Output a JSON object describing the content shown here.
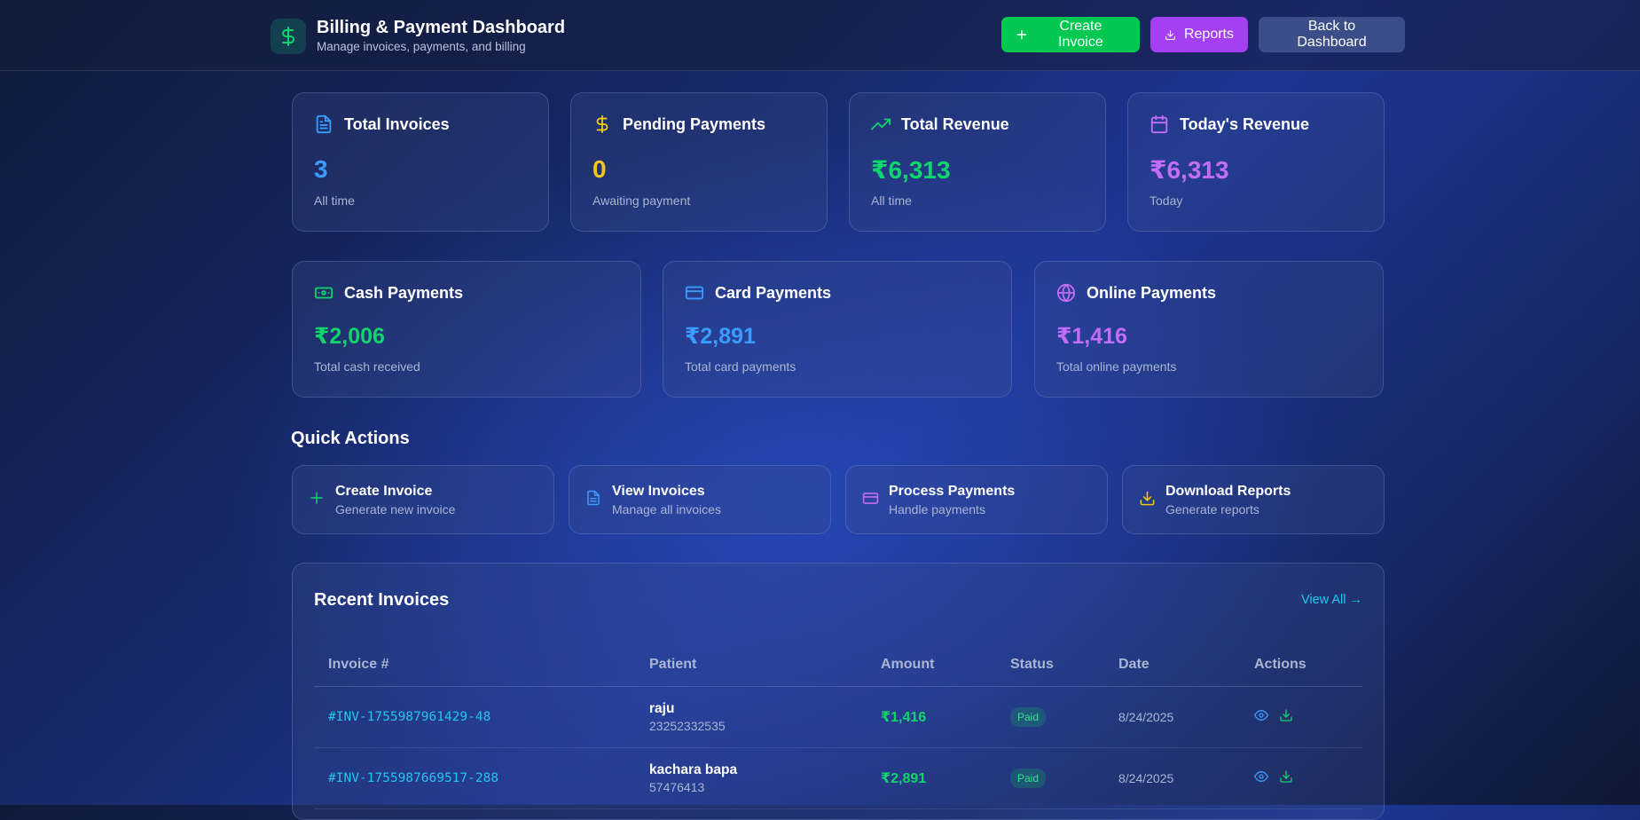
{
  "header": {
    "title": "Billing & Payment Dashboard",
    "subtitle": "Manage invoices, payments, and billing",
    "buttons": {
      "create": "Create Invoice",
      "reports": "Reports",
      "back": "Back to Dashboard"
    }
  },
  "stats": [
    {
      "title": "Total Invoices",
      "value": "3",
      "sub": "All time",
      "icon": "document-icon",
      "color": "#3b9cff"
    },
    {
      "title": "Pending Payments",
      "value": "0",
      "sub": "Awaiting payment",
      "icon": "dollar-icon",
      "color": "#f5c518"
    },
    {
      "title": "Total Revenue",
      "value": "₹6,313",
      "sub": "All time",
      "icon": "trending-up-icon",
      "color": "#10d46c"
    },
    {
      "title": "Today's Revenue",
      "value": "₹6,313",
      "sub": "Today",
      "icon": "calendar-icon",
      "color": "#c36cf5"
    }
  ],
  "payments": [
    {
      "title": "Cash Payments",
      "value": "₹2,006",
      "sub": "Total cash received",
      "icon": "cash-icon",
      "color": "#10d46c"
    },
    {
      "title": "Card Payments",
      "value": "₹2,891",
      "sub": "Total card payments",
      "icon": "credit-card-icon",
      "color": "#3b9cff"
    },
    {
      "title": "Online Payments",
      "value": "₹1,416",
      "sub": "Total online payments",
      "icon": "globe-icon",
      "color": "#c36cf5"
    }
  ],
  "quick_actions": {
    "title": "Quick Actions",
    "items": [
      {
        "title": "Create Invoice",
        "sub": "Generate new invoice",
        "icon": "plus-icon",
        "color": "#10d46c"
      },
      {
        "title": "View Invoices",
        "sub": "Manage all invoices",
        "icon": "document-icon",
        "color": "#3b9cff"
      },
      {
        "title": "Process Payments",
        "sub": "Handle payments",
        "icon": "credit-card-icon",
        "color": "#c36cf5"
      },
      {
        "title": "Download Reports",
        "sub": "Generate reports",
        "icon": "download-icon",
        "color": "#f5c518"
      }
    ]
  },
  "recent": {
    "title": "Recent Invoices",
    "view_all": "View All →",
    "columns": [
      "Invoice #",
      "Patient",
      "Amount",
      "Status",
      "Date",
      "Actions"
    ],
    "rows": [
      {
        "id": "#INV-1755987961429-48",
        "patient": "raju",
        "phone": "23252332535",
        "amount": "₹1,416",
        "status": "Paid",
        "date": "8/24/2025"
      },
      {
        "id": "#INV-1755987669517-288",
        "patient": "kachara bapa",
        "phone": "57476413",
        "amount": "₹2,891",
        "status": "Paid",
        "date": "8/24/2025"
      }
    ]
  }
}
